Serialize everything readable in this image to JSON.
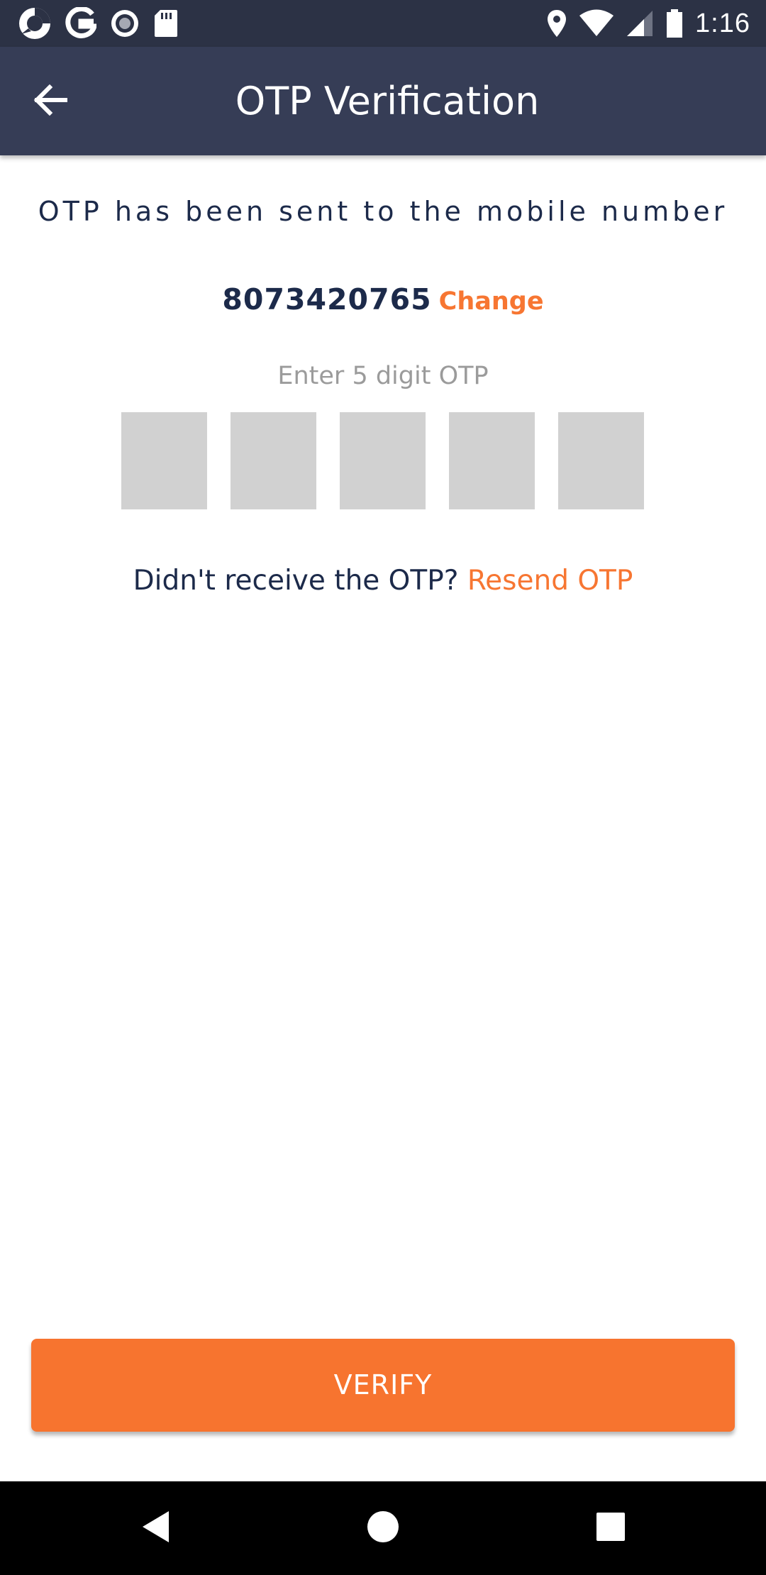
{
  "status_bar": {
    "time": "1:16",
    "left_icons": [
      "app-notification-icon",
      "google-icon",
      "record-icon",
      "sd-card-icon"
    ],
    "right_icons": [
      "location-icon",
      "wifi-icon",
      "signal-icon",
      "battery-icon"
    ]
  },
  "app_bar": {
    "title": "OTP Verification",
    "back_icon": "arrow-back-icon"
  },
  "content": {
    "sent_message": "OTP has been sent to the mobile number",
    "phone_number": "8073420765",
    "change_label": "Change",
    "otp_label": "Enter 5 digit OTP",
    "otp_digits": [
      "",
      "",
      "",
      "",
      ""
    ],
    "resend_prompt": "Didn't receive the OTP?",
    "resend_label": "Resend OTP"
  },
  "verify_button": {
    "label": "VERIFY"
  },
  "nav_bar": {
    "buttons": [
      "back-triangle-icon",
      "home-circle-icon",
      "recents-square-icon"
    ]
  },
  "colors": {
    "status_bar": "#2c3245",
    "app_bar": "#363d56",
    "accent": "#f7742f",
    "text_dark": "#1c2a4a",
    "text_muted": "#9b9b9b",
    "otp_box": "#d1d1d1"
  }
}
